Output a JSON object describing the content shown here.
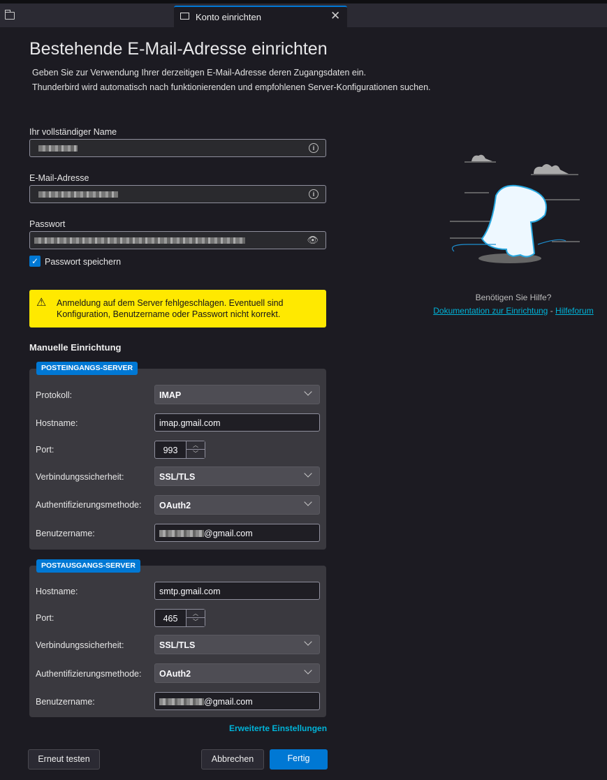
{
  "tab": {
    "title": "Konto einrichten",
    "close": "✕"
  },
  "page": {
    "title": "Bestehende E-Mail-Adresse einrichten",
    "desc1": "Geben Sie zur Verwendung Ihrer derzeitigen E-Mail-Adresse deren Zugangsdaten ein.",
    "desc2": "Thunderbird wird automatisch nach funktionierenden und empfohlenen Server-Konfigurationen suchen."
  },
  "form": {
    "name_label": "Ihr vollständiger Name",
    "email_label": "E-Mail-Adresse",
    "password_label": "Passwort",
    "save_password_label": "Passwort speichern",
    "save_password_checked": true
  },
  "warning": {
    "text": "Anmeldung auf dem Server fehlgeschlagen. Eventuell sind Konfiguration, Benutzername oder Passwort nicht korrekt."
  },
  "manual": {
    "heading": "Manuelle Einrichtung",
    "incoming": {
      "badge": "POSTEINGANGS-SERVER",
      "protocol_label": "Protokoll:",
      "protocol": "IMAP",
      "hostname_label": "Hostname:",
      "hostname": "imap.gmail.com",
      "port_label": "Port:",
      "port": "993",
      "security_label": "Verbindungssicherheit:",
      "security": "SSL/TLS",
      "auth_label": "Authentifizierungsmethode:",
      "auth": "OAuth2",
      "username_label": "Benutzername:",
      "username_suffix": "@gmail.com"
    },
    "outgoing": {
      "badge": "POSTAUSGANGS-SERVER",
      "hostname_label": "Hostname:",
      "hostname": "smtp.gmail.com",
      "port_label": "Port:",
      "port": "465",
      "security_label": "Verbindungssicherheit:",
      "security": "SSL/TLS",
      "auth_label": "Authentifizierungsmethode:",
      "auth": "OAuth2",
      "username_label": "Benutzername:",
      "username_suffix": "@gmail.com"
    },
    "advanced": "Erweiterte Einstellungen"
  },
  "buttons": {
    "retest": "Erneut testen",
    "cancel": "Abbrechen",
    "done": "Fertig"
  },
  "help": {
    "question": "Benötigen Sie Hilfe?",
    "doc_link": "Dokumentation zur Einrichtung",
    "sep": "-",
    "forum_link": "Hilfeforum"
  }
}
